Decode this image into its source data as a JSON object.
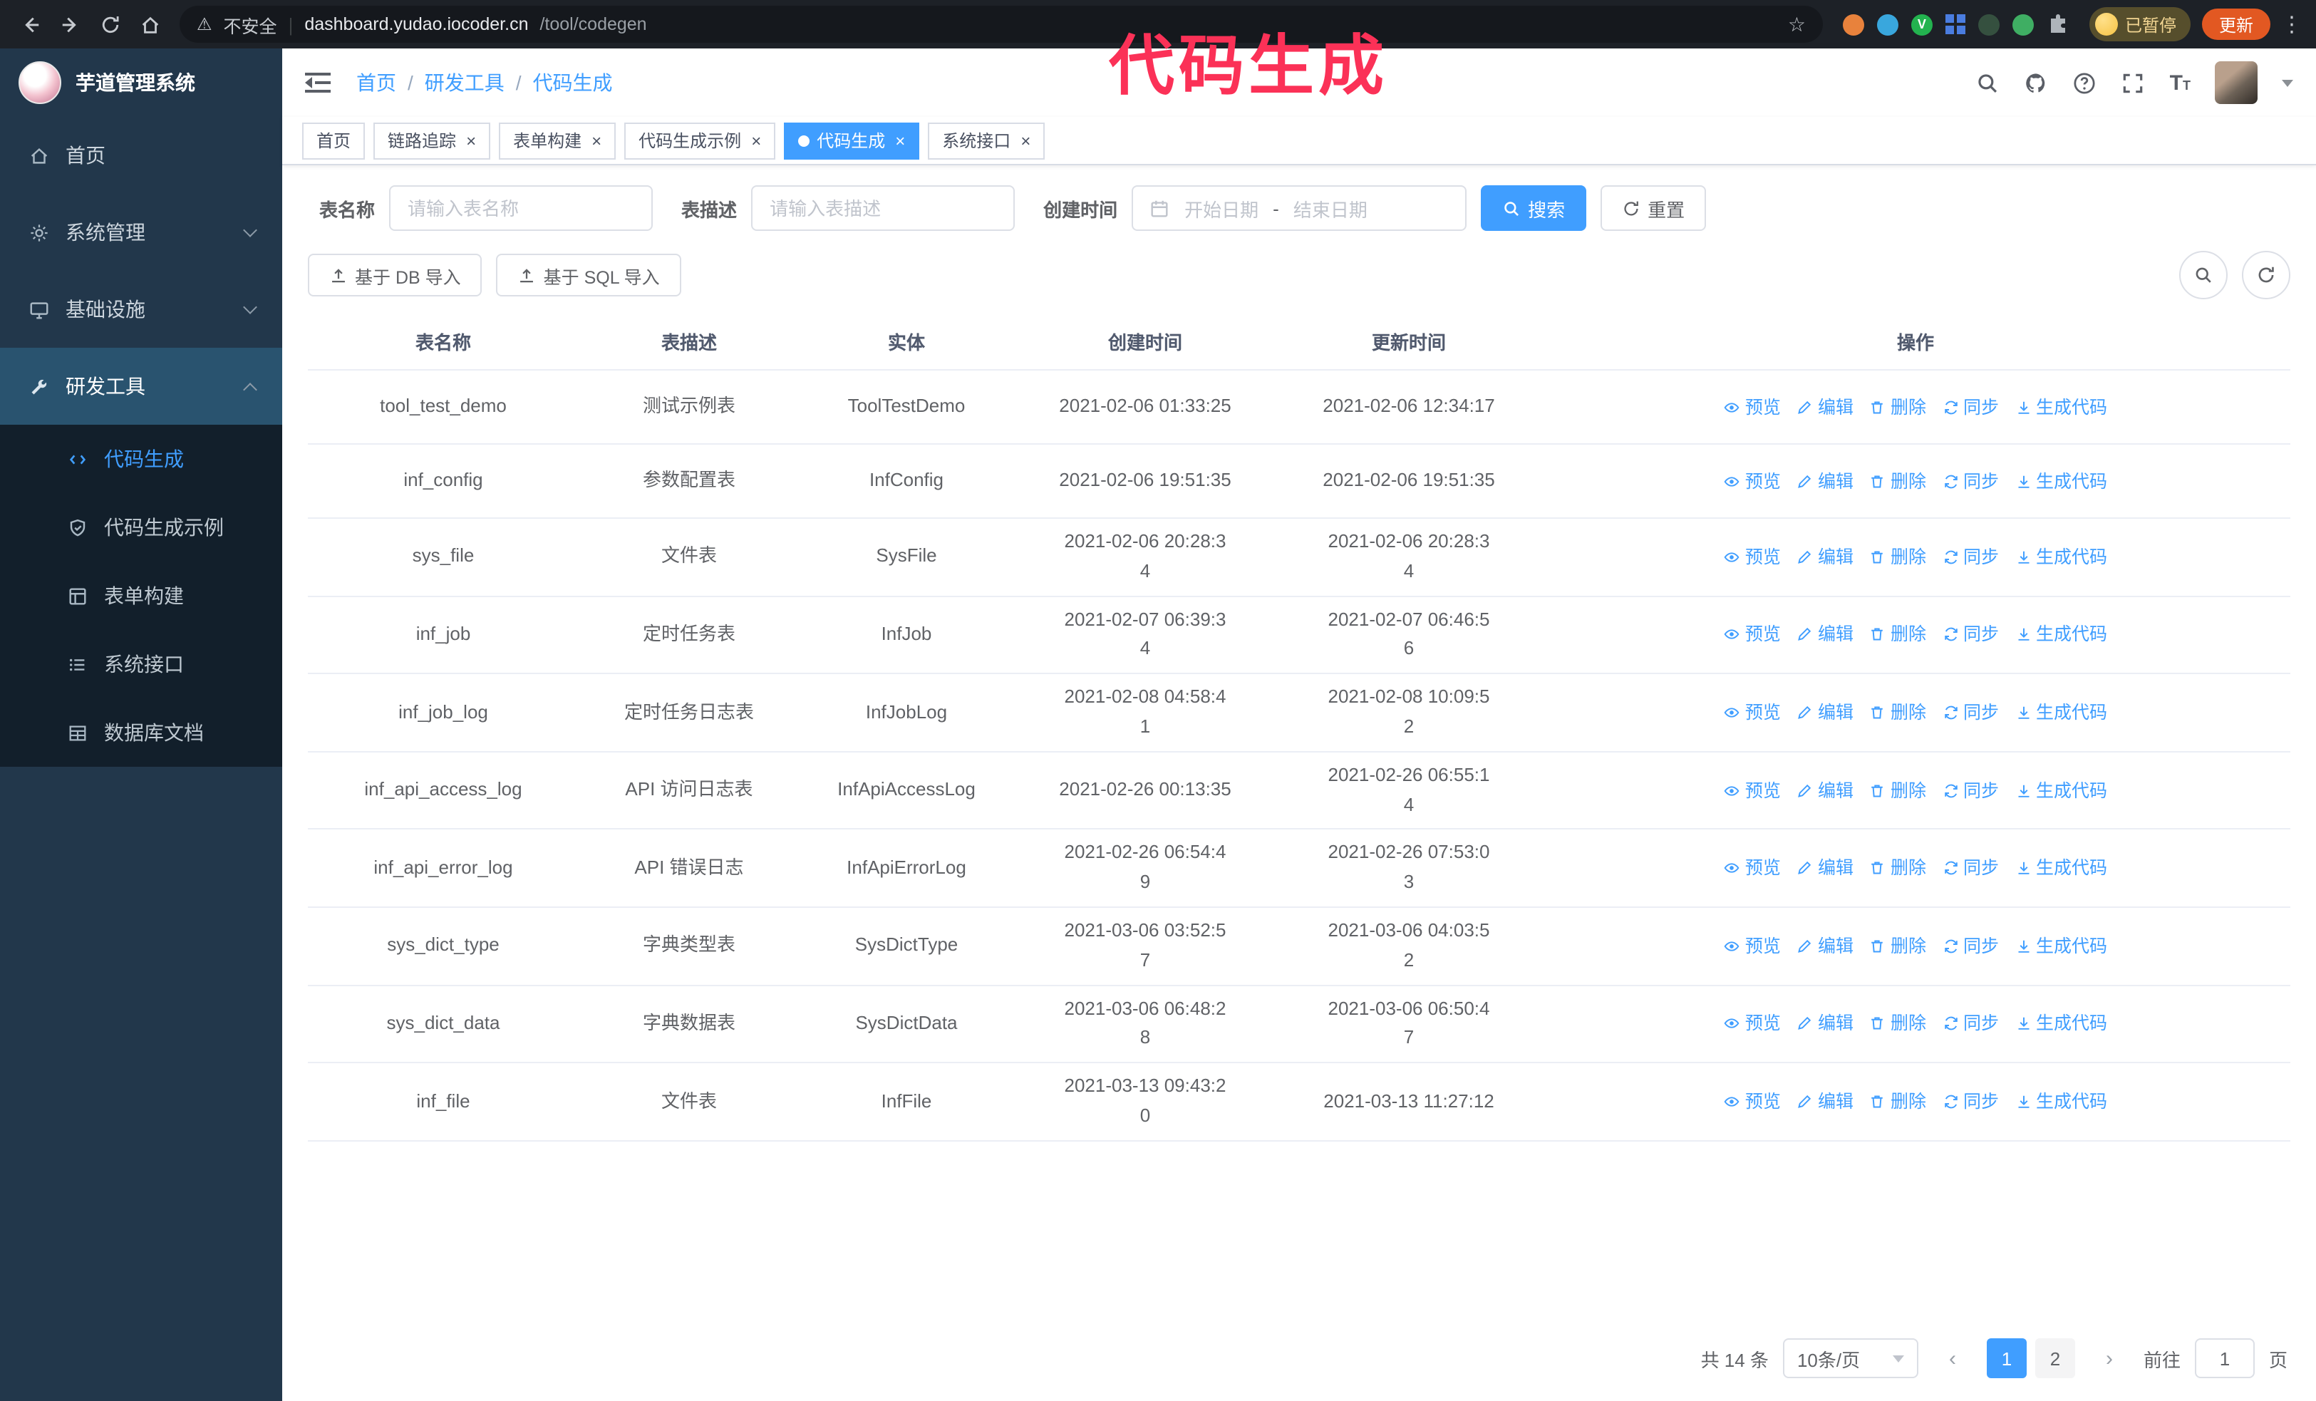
{
  "colors": {
    "accent": "#409eff",
    "annotation": "#fb3157",
    "sidebar_bg": "#22374b",
    "active_tab_bg": "#409eff"
  },
  "annotation": {
    "text": "代码生成"
  },
  "browser": {
    "insecure_label": "不安全",
    "url_host": "dashboard.yudao.iocoder.cn",
    "url_path": "/tool/codegen",
    "profile_label": "已暂停",
    "update_label": "更新",
    "extensions": [
      {
        "name": "orange-extension-icon",
        "color": "#e8823c",
        "shape": "circle"
      },
      {
        "name": "blue-extension-icon",
        "color": "#39a7dd",
        "shape": "circle"
      },
      {
        "name": "green-check-extension-icon",
        "color": "#23b34f",
        "shape": "circle",
        "glyph": "V"
      },
      {
        "name": "grid-extension-icon",
        "color": "#4a7de0",
        "shape": "grid"
      },
      {
        "name": "dark-extension-icon",
        "color": "#35503f",
        "shape": "circle"
      },
      {
        "name": "leaf-extension-icon",
        "color": "#3fae63",
        "shape": "circle"
      },
      {
        "name": "puzzle-icon",
        "color": "#aeb4ba",
        "shape": "puzzle"
      }
    ]
  },
  "sidebar": {
    "logo_title": "芋道管理系统",
    "items": [
      {
        "id": "home",
        "icon": "home",
        "label": "首页"
      },
      {
        "id": "system",
        "icon": "gear",
        "label": "系统管理",
        "expandable": true
      },
      {
        "id": "infra",
        "icon": "infra",
        "label": "基础设施",
        "expandable": true
      },
      {
        "id": "devtools",
        "icon": "tools",
        "label": "研发工具",
        "expandable": true,
        "expanded": true,
        "active": true
      }
    ],
    "subitems": [
      {
        "id": "codegen",
        "icon": "code",
        "label": "代码生成",
        "active": true
      },
      {
        "id": "codegen-example",
        "icon": "shield",
        "label": "代码生成示例"
      },
      {
        "id": "form-builder",
        "icon": "form",
        "label": "表单构建"
      },
      {
        "id": "system-api",
        "icon": "api",
        "label": "系统接口"
      },
      {
        "id": "db-doc",
        "icon": "db",
        "label": "数据库文档"
      }
    ]
  },
  "header": {
    "breadcrumb": {
      "0": "首页",
      "1": "研发工具",
      "2": "代码生成"
    }
  },
  "tabs": [
    {
      "label": "首页",
      "closable": false
    },
    {
      "label": "链路追踪",
      "closable": true
    },
    {
      "label": "表单构建",
      "closable": true
    },
    {
      "label": "代码生成示例",
      "closable": true
    },
    {
      "label": "代码生成",
      "closable": true,
      "active": true
    },
    {
      "label": "系统接口",
      "closable": true
    }
  ],
  "filters": {
    "name_label": "表名称",
    "name_placeholder": "请输入表名称",
    "desc_label": "表描述",
    "desc_placeholder": "请输入表描述",
    "time_label": "创建时间",
    "start_placeholder": "开始日期",
    "range_separator": "-",
    "end_placeholder": "结束日期",
    "search_label": "搜索",
    "reset_label": "重置"
  },
  "toolbar": {
    "import_db_label": "基于 DB 导入",
    "import_sql_label": "基于 SQL 导入"
  },
  "table": {
    "columns": {
      "0": "表名称",
      "1": "表描述",
      "2": "实体",
      "3": "创建时间",
      "4": "更新时间",
      "5": "操作"
    },
    "actions": [
      "预览",
      "编辑",
      "删除",
      "同步",
      "生成代码"
    ],
    "rows": [
      {
        "name": "tool_test_demo",
        "desc": "测试示例表",
        "entity": "ToolTestDemo",
        "created": "2021-02-06 01:33:25",
        "updated": "2021-02-06 12:34:17"
      },
      {
        "name": "inf_config",
        "desc": "参数配置表",
        "entity": "InfConfig",
        "created": "2021-02-06 19:51:35",
        "updated": "2021-02-06 19:51:35"
      },
      {
        "name": "sys_file",
        "desc": "文件表",
        "entity": "SysFile",
        "created": "2021-02-06 20:28:3\n4",
        "updated": "2021-02-06 20:28:3\n4"
      },
      {
        "name": "inf_job",
        "desc": "定时任务表",
        "entity": "InfJob",
        "created": "2021-02-07 06:39:3\n4",
        "updated": "2021-02-07 06:46:5\n6"
      },
      {
        "name": "inf_job_log",
        "desc": "定时任务日志表",
        "entity": "InfJobLog",
        "created": "2021-02-08 04:58:4\n1",
        "updated": "2021-02-08 10:09:5\n2"
      },
      {
        "name": "inf_api_access_log",
        "desc": "API 访问日志表",
        "entity": "InfApiAccessLog",
        "created": "2021-02-26 00:13:35",
        "updated": "2021-02-26 06:55:1\n4"
      },
      {
        "name": "inf_api_error_log",
        "desc": "API 错误日志",
        "entity": "InfApiErrorLog",
        "created": "2021-02-26 06:54:4\n9",
        "updated": "2021-02-26 07:53:0\n3"
      },
      {
        "name": "sys_dict_type",
        "desc": "字典类型表",
        "entity": "SysDictType",
        "created": "2021-03-06 03:52:5\n7",
        "updated": "2021-03-06 04:03:5\n2"
      },
      {
        "name": "sys_dict_data",
        "desc": "字典数据表",
        "entity": "SysDictData",
        "created": "2021-03-06 06:48:2\n8",
        "updated": "2021-03-06 06:50:4\n7"
      },
      {
        "name": "inf_file",
        "desc": "文件表",
        "entity": "InfFile",
        "created": "2021-03-13 09:43:2\n0",
        "updated": "2021-03-13 11:27:12"
      }
    ]
  },
  "pagination": {
    "total": "共 14 条",
    "page_size": "10条/页",
    "pages": [
      "1",
      "2"
    ],
    "active_page": "1",
    "goto_label": "前往",
    "goto_value": "1",
    "page_label": "页"
  }
}
